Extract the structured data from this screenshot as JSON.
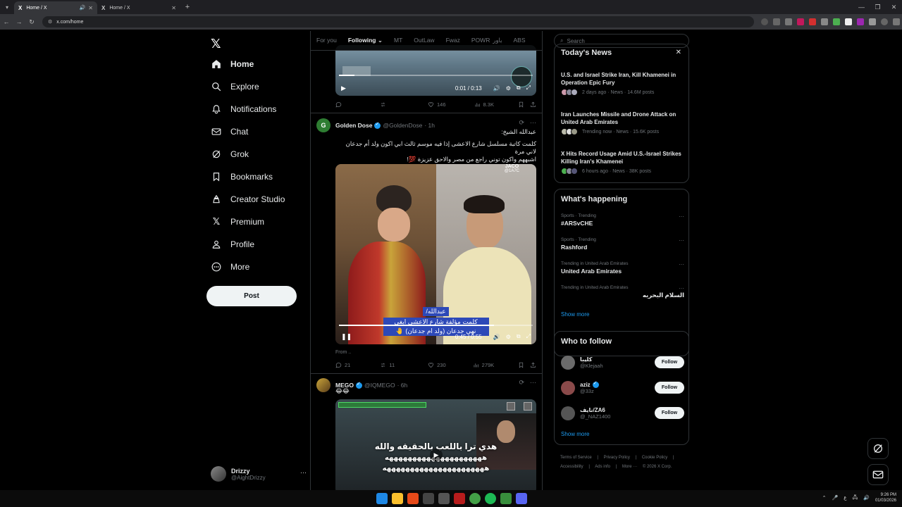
{
  "browser": {
    "tabs": [
      {
        "title": "Home / X",
        "active": true
      },
      {
        "title": "Home / X",
        "active": false
      }
    ],
    "url": "x.com/home"
  },
  "sidebar": {
    "items": [
      {
        "label": "Home",
        "icon": "home-icon",
        "active": true
      },
      {
        "label": "Explore",
        "icon": "search-icon"
      },
      {
        "label": "Notifications",
        "icon": "bell-icon"
      },
      {
        "label": "Chat",
        "icon": "mail-icon"
      },
      {
        "label": "Grok",
        "icon": "grok-icon"
      },
      {
        "label": "Bookmarks",
        "icon": "bookmark-icon"
      },
      {
        "label": "Creator Studio",
        "icon": "creator-icon"
      },
      {
        "label": "Premium",
        "icon": "x-icon"
      },
      {
        "label": "Profile",
        "icon": "person-icon"
      },
      {
        "label": "More",
        "icon": "more-circle-icon"
      }
    ],
    "post_label": "Post",
    "account": {
      "name": "Drizzy",
      "handle": "@AightDrizzy",
      "more": "···"
    }
  },
  "feed": {
    "tabs": [
      "For you",
      "Following",
      "MT",
      "OutLaw",
      "Fwaz",
      "POWR",
      "باور",
      "ABS"
    ],
    "active_tab": "Following",
    "video1": {
      "time": "0:01 / 0:13",
      "progress": 0.08
    },
    "tweet1_actions": {
      "replies": "",
      "reposts": "",
      "likes": "146",
      "views": "8.3K"
    },
    "tweet2": {
      "name": "Golden Dose",
      "handle": "@GoldenDose",
      "time": "· 1h",
      "text_line1": "عبدالله الشيخ:",
      "text_line2": "كلمت كاتبة مسلسل شارع الاعشى إذا فيه موسم ثالث ابي اكون ولد أم جدعان لاني مرة",
      "text_line3": "اشبههم واكون توني راجع من مصر والاحق عزيزة 💯!",
      "video_watermark": "JACO",
      "video_watermark_handle": "@1A7C",
      "caption_name": "عبدالله/",
      "caption_line1": "كلمت مؤلفة شارع الاعشى ابغى",
      "caption_line2": "نهي جدعان (ولد ام جدعان) 🤚",
      "video_time": "0:45 / 0:55",
      "progress": 0.8,
      "from_label": "From ..",
      "replies": "21",
      "reposts": "11",
      "likes": "230",
      "views": "279K"
    },
    "tweet3": {
      "name": "MEGO",
      "handle": "@IQMEGO",
      "time": "· 6h",
      "text": "😂😂",
      "overlay_line1": "هدي ترا باللعب بالحقيقه والله",
      "overlay_line2": "هههههههههههههههههههههه",
      "overlay_line3": "ههههههههههههههههههههههه"
    }
  },
  "right": {
    "search_placeholder": "Search",
    "news_title": "Today's News",
    "news": [
      {
        "headline": "U.S. and Israel Strike Iran, Kill Khamenei in Operation Epic Fury",
        "meta": "2 days ago · News · 14.6M posts"
      },
      {
        "headline": "Iran Launches Missile and Drone Attack on United Arab Emirates",
        "meta": "Trending now · News · 15.6K posts"
      },
      {
        "headline": "X Hits Record Usage Amid U.S.-Israel Strikes Killing Iran's Khamenei",
        "meta": "6 hours ago · News · 38K posts"
      }
    ],
    "happening_title": "What's happening",
    "trends": [
      {
        "category": "Sports · Trending",
        "name": "#ARSvCHE"
      },
      {
        "category": "Sports · Trending",
        "name": "Rashford"
      },
      {
        "category": "Trending in United Arab Emirates",
        "name": "United Arab Emirates"
      },
      {
        "category": "Trending in United Arab Emirates",
        "name": "السلام البحريه"
      }
    ],
    "show_more": "Show more",
    "follow_title": "Who to follow",
    "follows": [
      {
        "name": "كليبا",
        "handle": "@Klejaah",
        "verified": false,
        "color": "#6b6b6b"
      },
      {
        "name": "aziz",
        "handle": "@33z",
        "verified": true,
        "color": "#8a4a4a"
      },
      {
        "name": "نايف/ZA6",
        "handle": "@_NAZ1400",
        "verified": false,
        "color": "#555"
      }
    ],
    "follow_label": "Follow",
    "footer": [
      "Terms of Service",
      "|",
      "Privacy Policy",
      "|",
      "Cookie Policy",
      "|",
      "Accessibility",
      "|",
      "Ads info",
      "|",
      "More ···",
      "© 2026 X Corp."
    ]
  },
  "taskbar": {
    "time": "9:26 PM",
    "date": "01/03/2026",
    "lang": "ع"
  },
  "colors": {
    "accent": "#1d9bf0",
    "background": "#000000",
    "border": "#2f3336"
  }
}
